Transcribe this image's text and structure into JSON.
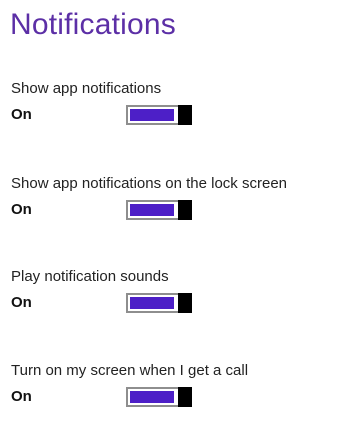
{
  "page": {
    "title": "Notifications"
  },
  "settings": [
    {
      "label": "Show app notifications",
      "state": "On",
      "enabled": true
    },
    {
      "label": "Show app notifications on the lock screen",
      "state": "On",
      "enabled": true
    },
    {
      "label": "Play notification sounds",
      "state": "On",
      "enabled": true
    },
    {
      "label": "Turn on my screen when I get a call",
      "state": "On",
      "enabled": true
    }
  ],
  "colors": {
    "accent_title": "#5c2fa6",
    "toggle_fill": "#4d1fc7",
    "toggle_thumb": "#000000",
    "toggle_border": "#8e8e8e"
  }
}
